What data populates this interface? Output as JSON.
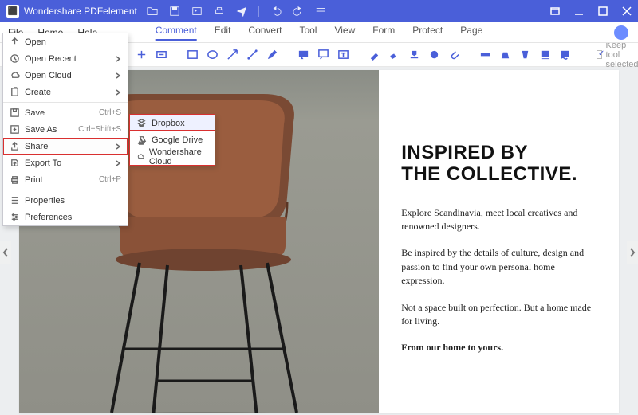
{
  "titlebar": {
    "app_name": "Wondershare PDFelement"
  },
  "quick_icons": [
    "folder-icon",
    "save-icon",
    "gallery-icon",
    "print-icon",
    "send-icon",
    "divider",
    "undo-icon",
    "redo-icon",
    "customize-icon"
  ],
  "menubar": {
    "items": [
      "File",
      "Home",
      "Help"
    ]
  },
  "tabs": {
    "items": [
      "Comment",
      "Edit",
      "Convert",
      "Tool",
      "View",
      "Form",
      "Protect",
      "Page"
    ],
    "active": "Comment"
  },
  "toolbar": {
    "groups": [
      [
        "hand-icon",
        "select-icon",
        "zoom-icon",
        "fit-width-icon"
      ],
      [
        "rectangle-icon",
        "oval-icon",
        "arrow-icon",
        "line-icon",
        "pencil-icon"
      ],
      [
        "highlight-icon",
        "callout-icon",
        "textbox-icon"
      ],
      [
        "stamp-icon",
        "eraser-icon",
        "signature-icon",
        "link-icon",
        "attachment-icon"
      ],
      [
        "measure-icon",
        "area-highlight-icon",
        "strikethrough-icon",
        "underline-icon",
        "squiggly-icon"
      ]
    ],
    "keep_tool_selected": "Keep tool selected"
  },
  "file_menu": {
    "items": [
      {
        "icon": "open-icon",
        "label": "Open",
        "shortcut": "",
        "has_submenu": false
      },
      {
        "icon": "open-recent-icon",
        "label": "Open Recent",
        "shortcut": "",
        "has_submenu": true
      },
      {
        "icon": "open-cloud-icon",
        "label": "Open Cloud",
        "shortcut": "",
        "has_submenu": true
      },
      {
        "icon": "create-icon",
        "label": "Create",
        "shortcut": "",
        "has_submenu": true
      },
      {
        "icon": "save-icon",
        "label": "Save",
        "shortcut": "Ctrl+S",
        "has_submenu": false
      },
      {
        "icon": "save-as-icon",
        "label": "Save As",
        "shortcut": "Ctrl+Shift+S",
        "has_submenu": false
      },
      {
        "icon": "share-icon",
        "label": "Share",
        "shortcut": "",
        "has_submenu": true,
        "selected": true
      },
      {
        "icon": "export-icon",
        "label": "Export To",
        "shortcut": "",
        "has_submenu": true
      },
      {
        "icon": "print-icon",
        "label": "Print",
        "shortcut": "Ctrl+P",
        "has_submenu": false
      },
      {
        "icon": "properties-icon",
        "label": "Properties",
        "shortcut": "",
        "has_submenu": false
      },
      {
        "icon": "preferences-icon",
        "label": "Preferences",
        "shortcut": "",
        "has_submenu": false
      }
    ]
  },
  "share_submenu": {
    "items": [
      {
        "icon": "dropbox-icon",
        "label": "Dropbox",
        "selected": true
      },
      {
        "icon": "google-drive-icon",
        "label": "Google Drive"
      },
      {
        "icon": "wondershare-cloud-icon",
        "label": "Wondershare Cloud"
      }
    ]
  },
  "document": {
    "heading_line1": "INSPIRED BY",
    "heading_line2": "THE COLLECTIVE.",
    "para1": "Explore Scandinavia, meet local creatives and renowned designers.",
    "para2": "Be inspired by the details of culture, design and passion to find your own personal home expression.",
    "para3": "Not a space built on perfection. But a home made for living.",
    "para4": "From our home to yours."
  },
  "colors": {
    "accent": "#4a5fd9",
    "highlight_border": "#d93030"
  }
}
